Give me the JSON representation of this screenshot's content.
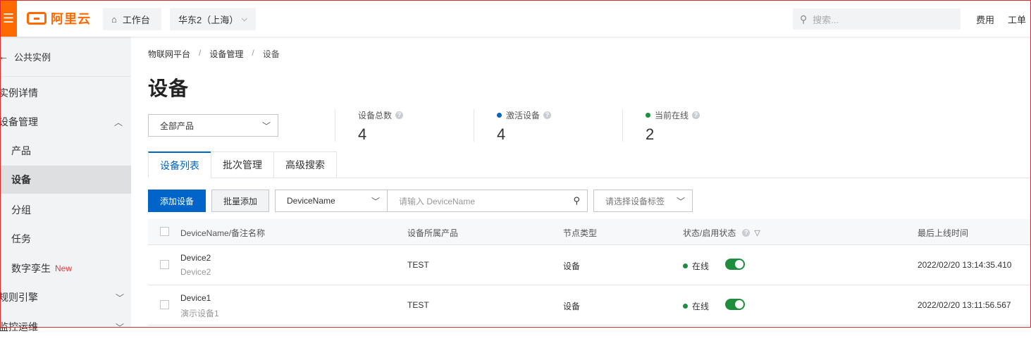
{
  "topbar": {
    "logo_text": "阿里云",
    "workbench_label": "工作台",
    "region_label": "华东2（上海）",
    "search_placeholder": "搜索...",
    "fees_label": "费用",
    "ticket_label": "工单"
  },
  "sidebar": {
    "back_label": "公共实例",
    "items": [
      {
        "label": "实例详情"
      },
      {
        "label": "设备管理"
      },
      {
        "label": "产品"
      },
      {
        "label": "设备"
      },
      {
        "label": "分组"
      },
      {
        "label": "任务"
      },
      {
        "label": "数字孪生",
        "badge": "New"
      },
      {
        "label": "规则引擎"
      },
      {
        "label": "监控运维"
      }
    ]
  },
  "breadcrumb": [
    "物联网平台",
    "设备管理",
    "设备"
  ],
  "page_title": "设备",
  "product_select": "全部产品",
  "stats": [
    {
      "label": "设备总数",
      "value": "4"
    },
    {
      "label": "激活设备",
      "value": "4",
      "dot_color": "#0064c8"
    },
    {
      "label": "当前在线",
      "value": "2",
      "dot_color": "#1e8e3e"
    }
  ],
  "tabs": [
    "设备列表",
    "批次管理",
    "高级搜索"
  ],
  "toolbar": {
    "add_label": "添加设备",
    "batch_label": "批量添加",
    "field_select": "DeviceName",
    "search_placeholder": "请输入 DeviceName",
    "tag_select": "请选择设备标签"
  },
  "table": {
    "columns": [
      "DeviceName/备注名称",
      "设备所属产品",
      "节点类型",
      "状态/启用状态",
      "最后上线时间"
    ],
    "rows": [
      {
        "name": "Device2",
        "note": "Device2",
        "product": "TEST",
        "node_type": "设备",
        "status": "在线",
        "enabled": true,
        "last_online": "2022/02/20 13:14:35.410"
      },
      {
        "name": "Device1",
        "note": "演示设备1",
        "product": "TEST",
        "node_type": "设备",
        "status": "在线",
        "enabled": true,
        "last_online": "2022/02/20 13:11:56.567"
      }
    ]
  },
  "colors": {
    "brand": "#ff6a00",
    "primary": "#0064c8",
    "online": "#1e8e3e"
  }
}
